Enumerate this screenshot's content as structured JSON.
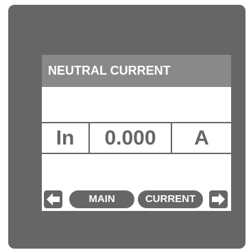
{
  "screen": {
    "title": "NEUTRAL CURRENT"
  },
  "reading": {
    "parameter": "In",
    "value": "0.000",
    "unit": "A"
  },
  "nav": {
    "left_icon": "arrow-left-icon",
    "main_label": "MAIN",
    "current_label": "CURRENT",
    "right_icon": "arrow-right-icon"
  },
  "colors": {
    "bezel": "#666666",
    "title_bar": "#898989",
    "screen_bg": "#ffffff",
    "text": "#666666"
  }
}
